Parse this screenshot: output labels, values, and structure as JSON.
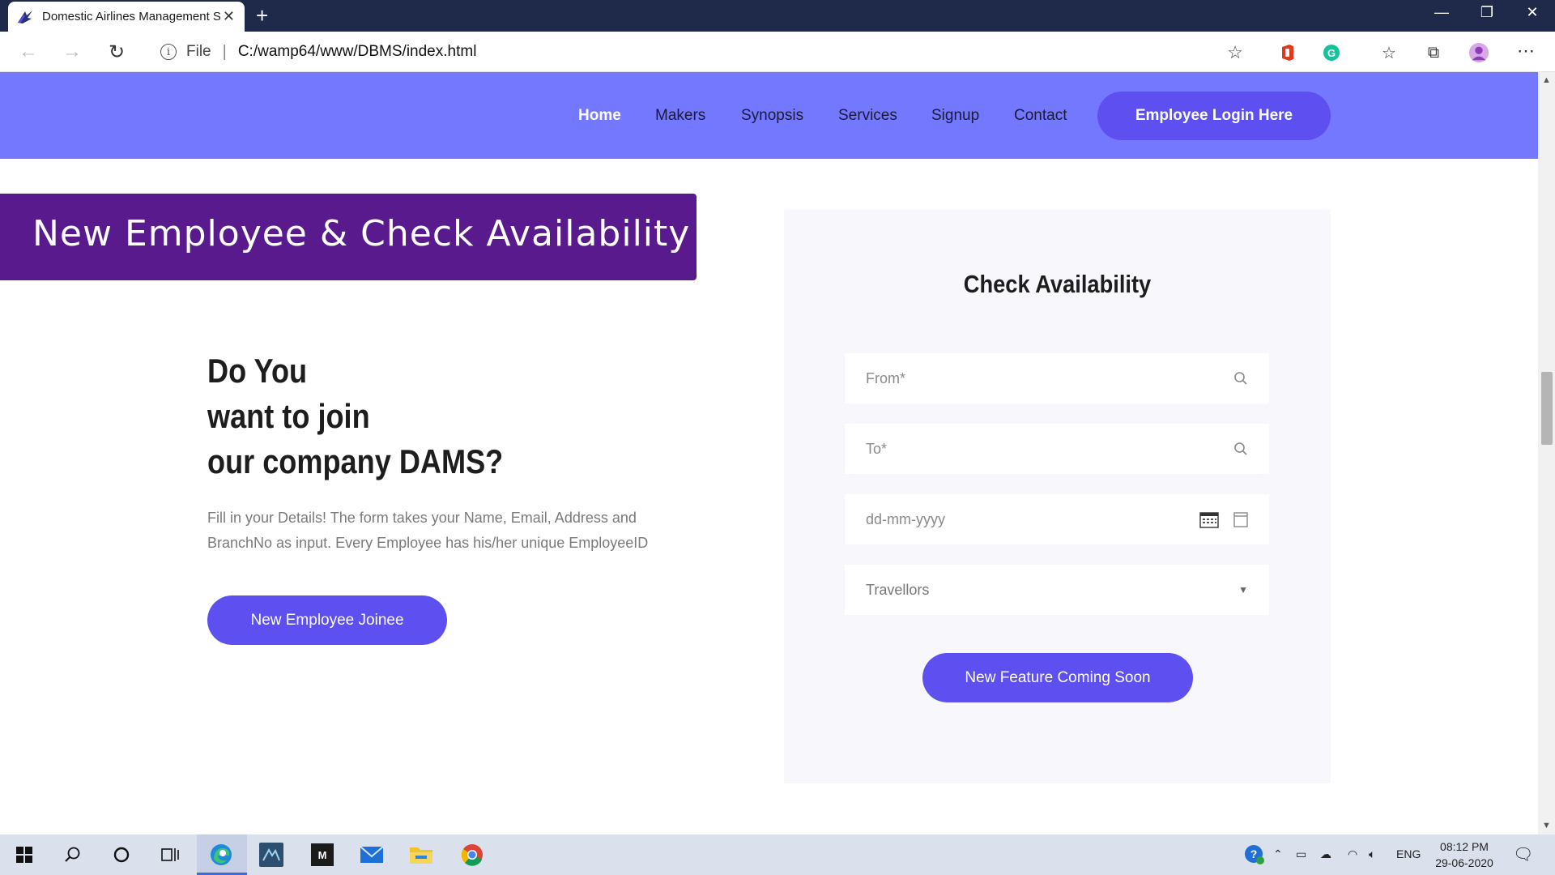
{
  "browser": {
    "tab_title": "Domestic Airlines Management S",
    "url_scheme_label": "File",
    "url": "C:/wamp64/www/DBMS/index.html"
  },
  "nav": {
    "items": [
      {
        "label": "Home",
        "active": true
      },
      {
        "label": "Makers"
      },
      {
        "label": "Synopsis"
      },
      {
        "label": "Services"
      },
      {
        "label": "Signup"
      },
      {
        "label": "Contact"
      }
    ],
    "login_button": "Employee Login Here"
  },
  "banner": {
    "title": "New Employee & Check Availability"
  },
  "join": {
    "headline": [
      "Do You",
      "want to join",
      "our company DAMS?"
    ],
    "description": "Fill in your Details! The form takes your Name, Email, Address and BranchNo as input. Every Employee has his/her unique EmployeeID",
    "button": "New Employee Joinee"
  },
  "availability": {
    "title": "Check Availability",
    "from_placeholder": "From*",
    "to_placeholder": "To*",
    "date_placeholder": "dd-mm-yyyy",
    "travellers_placeholder": "Travellors",
    "button": "New Feature Coming Soon"
  },
  "taskbar": {
    "language": "ENG",
    "time": "08:12 PM",
    "date": "29-06-2020"
  },
  "colors": {
    "header_bg": "#7478ff",
    "primary_button": "#5e4ff0",
    "banner_bg": "#581a8d",
    "card_bg": "#f7f7fc"
  }
}
